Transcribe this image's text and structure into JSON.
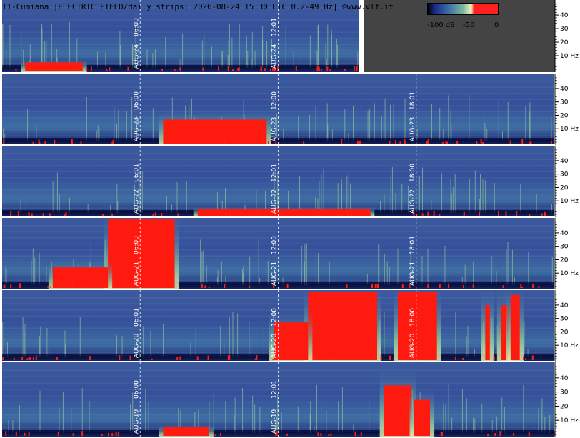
{
  "header": {
    "title": "I1-Cumiana |ELECTRIC FIELD/daily strips| 2026-08-24 15:30 UTC 0.2-49 Hz| ©www.vlf.it"
  },
  "legend": {
    "labels": [
      "-100 dB",
      "-50",
      "0"
    ],
    "colors": [
      "#000000",
      "#1a2a8c",
      "#3c6fa8",
      "#7ab89a",
      "#f0f4c0",
      "#ff2020"
    ]
  },
  "chart_data": {
    "type": "heatmap",
    "title": "I1-Cumiana |ELECTRIC FIELD/daily strips| 2026-08-24 15:30 UTC 0.2-49 Hz| ©www.vlf.it",
    "ylabel": "Hz",
    "ylim": [
      0,
      49
    ],
    "yticks": [
      {
        "value": 10,
        "label": "10 Hz"
      },
      {
        "value": 20,
        "label": "20"
      },
      {
        "value": 30,
        "label": "30"
      },
      {
        "value": 40,
        "label": "40"
      }
    ],
    "color_scale": {
      "min_db": -100,
      "max_db": 0,
      "tick_labels": [
        "-100 dB",
        "-50",
        "0"
      ]
    },
    "strips": [
      {
        "date": "AUG-24",
        "time_markers": [
          "06:00",
          "12:01"
        ],
        "data_end_hour": 15.5,
        "red_bursts": [
          [
            1.0,
            3.5,
            0.12
          ]
        ]
      },
      {
        "date": "AUG-23",
        "time_markers": [
          "06:00",
          "12:00",
          "18:01"
        ],
        "data_end_hour": 24,
        "red_bursts": [
          [
            7.0,
            11.5,
            0.35
          ]
        ]
      },
      {
        "date": "AUG-22",
        "time_markers": [
          "06:01",
          "12:01",
          "18:00"
        ],
        "data_end_hour": 24,
        "red_bursts": [
          [
            8.5,
            16.0,
            0.1
          ]
        ]
      },
      {
        "date": "AUG-21",
        "time_markers": [
          "06:00",
          "12:00",
          "18:01"
        ],
        "data_end_hour": 24,
        "red_bursts": [
          [
            4.6,
            7.5,
            1.0
          ],
          [
            2.2,
            4.6,
            0.3
          ]
        ]
      },
      {
        "date": "AUG-20",
        "time_markers": [
          "06:01",
          "12:00",
          "18:00"
        ],
        "data_end_hour": 24,
        "red_bursts": [
          [
            13.3,
            16.3,
            1.0
          ],
          [
            17.2,
            18.9,
            1.0
          ],
          [
            11.8,
            13.3,
            0.55
          ],
          [
            21.0,
            21.2,
            0.8
          ],
          [
            21.7,
            22.0,
            0.8
          ],
          [
            22.1,
            22.5,
            0.95
          ]
        ]
      },
      {
        "date": "AUG-19",
        "time_markers": [
          "06:00",
          "12:01"
        ],
        "data_end_hour": 24,
        "red_bursts": [
          [
            16.6,
            17.8,
            0.7
          ],
          [
            17.9,
            18.6,
            0.5
          ],
          [
            7.0,
            9.0,
            0.12
          ]
        ]
      }
    ]
  }
}
